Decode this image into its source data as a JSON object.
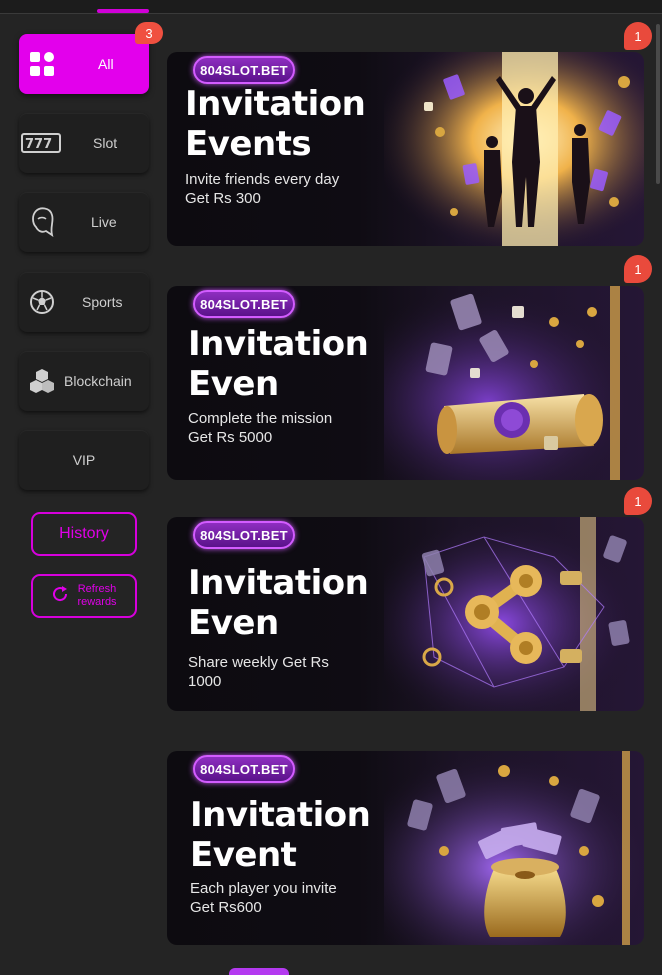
{
  "sidebar": {
    "categories": [
      {
        "label": "All",
        "icon": "grid-icon",
        "active": true
      },
      {
        "label": "Slot",
        "icon": "slot-777-icon"
      },
      {
        "label": "Live",
        "icon": "dealer-face-icon"
      },
      {
        "label": "Sports",
        "icon": "soccer-ball-icon"
      },
      {
        "label": "Blockchain",
        "icon": "blockchain-cubes-icon"
      },
      {
        "label": "VIP",
        "icon": ""
      }
    ],
    "all_badge": "3",
    "history_label": "History",
    "refresh_label_line1": "Refresh",
    "refresh_label_line2": "rewards"
  },
  "banners": [
    {
      "logo": "804SLOT.BET",
      "title_line1": "Invitation",
      "title_line2": "Events",
      "sub_line1": "Invite friends every day",
      "sub_line2": "Get Rs 300",
      "badge": "1",
      "art": "celebrating-people-doorway"
    },
    {
      "logo": "804SLOT.BET",
      "title_line1": "Invitation",
      "title_line2": "Even",
      "sub_line1": "Complete the mission",
      "sub_line2": "Get Rs 5000",
      "badge": "1",
      "art": "gold-scroll-wax-seal"
    },
    {
      "logo": "804SLOT.BET",
      "title_line1": "Invitation",
      "title_line2": "Even",
      "sub_line1": "Share weekly Get Rs",
      "sub_line2": "1000",
      "badge": "1",
      "art": "gold-share-symbol"
    },
    {
      "logo": "804SLOT.BET",
      "title_line1": "Invitation",
      "title_line2": "Event",
      "sub_line1": "Each player you invite",
      "sub_line2": "Get Rs600",
      "badge": "",
      "art": "money-bag-cash"
    }
  ],
  "colors": {
    "accent": "#e300ec",
    "badge": "#e94a3c",
    "background": "#242424",
    "card": "#1f1f1f"
  }
}
